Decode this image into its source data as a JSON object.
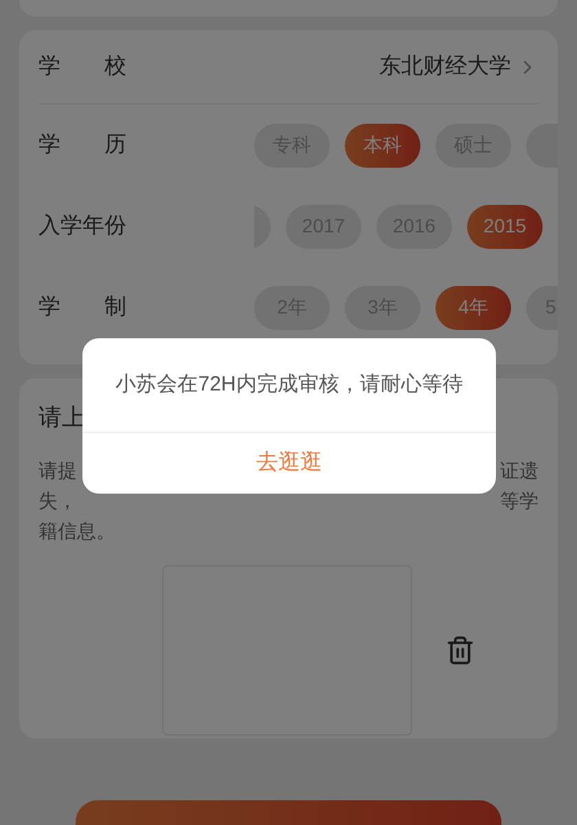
{
  "school": {
    "label": "学　　校",
    "value": "东北财经大学"
  },
  "option_rows": [
    {
      "label": "学　　历",
      "options": [
        {
          "label": "专科",
          "selected": false
        },
        {
          "label": "本科",
          "selected": true
        },
        {
          "label": "硕士",
          "selected": false
        },
        {
          "selected": false
        }
      ]
    },
    {
      "label": "入学年份",
      "options": [
        {
          "selected": false
        },
        {
          "label": "2017",
          "selected": false
        },
        {
          "label": "2016",
          "selected": false
        },
        {
          "label": "2015",
          "selected": true
        }
      ]
    },
    {
      "label": "学　　制",
      "options": [
        {
          "label": "2年",
          "selected": false
        },
        {
          "label": "3年",
          "selected": false
        },
        {
          "label": "4年",
          "selected": true
        },
        {
          "label": "5",
          "selected": false
        }
      ]
    }
  ],
  "upload": {
    "title": "请上",
    "description_lines": [
      {
        "left": "请提",
        "right": "证遗"
      },
      {
        "left": "失，",
        "right": "等学"
      },
      {
        "left": "籍信息。"
      }
    ]
  },
  "dialog": {
    "message": "小苏会在72H内完成审核，请耐心等待",
    "action": "去逛逛"
  }
}
